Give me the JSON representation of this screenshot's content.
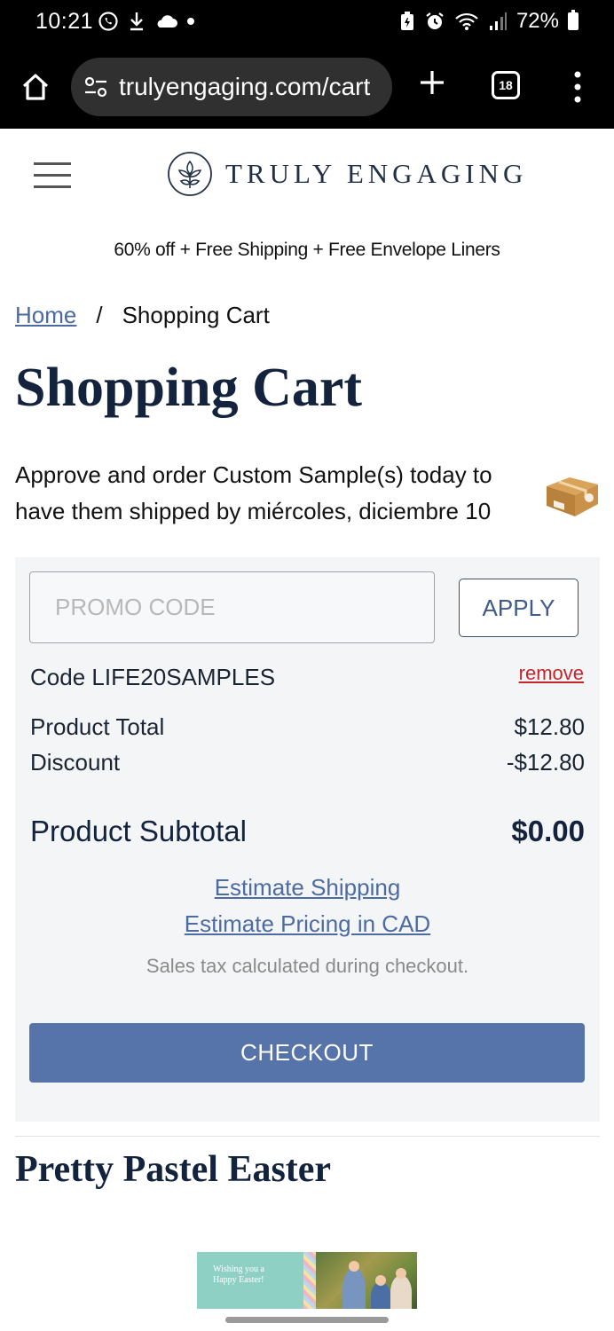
{
  "status_bar": {
    "time": "10:21",
    "battery": "72%"
  },
  "browser": {
    "url": "trulyengaging.com/cart",
    "tab_count": "18"
  },
  "site": {
    "logo_text": "TRULY ENGAGING",
    "promo_banner": "60% off + Free Shipping + Free Envelope Liners"
  },
  "breadcrumb": {
    "home": "Home",
    "separator": "/",
    "current": "Shopping Cart"
  },
  "page_title": "Shopping Cart",
  "shipping_note": "Approve and order Custom Sample(s) today to have them shipped by miércoles, diciembre 10",
  "cart": {
    "promo_placeholder": "PROMO CODE",
    "apply_label": "APPLY",
    "code_applied": "Code LIFE20SAMPLES",
    "remove_label": "remove",
    "product_total_label": "Product Total",
    "product_total_value": "$12.80",
    "discount_label": "Discount",
    "discount_value": "-$12.80",
    "subtotal_label": "Product Subtotal",
    "subtotal_value": "$0.00",
    "estimate_shipping": "Estimate Shipping",
    "estimate_cad": "Estimate Pricing in CAD",
    "tax_note": "Sales tax calculated during checkout.",
    "checkout_label": "CHECKOUT"
  },
  "recommendation": {
    "section_title": "Pretty Pastel Easter",
    "card_line1": "Wishing you a",
    "card_line2": "Happy Easter!"
  },
  "colors": {
    "accent": "#5673aa",
    "link": "#4d6ba3",
    "remove": "#c4242a",
    "title": "#13233d"
  }
}
